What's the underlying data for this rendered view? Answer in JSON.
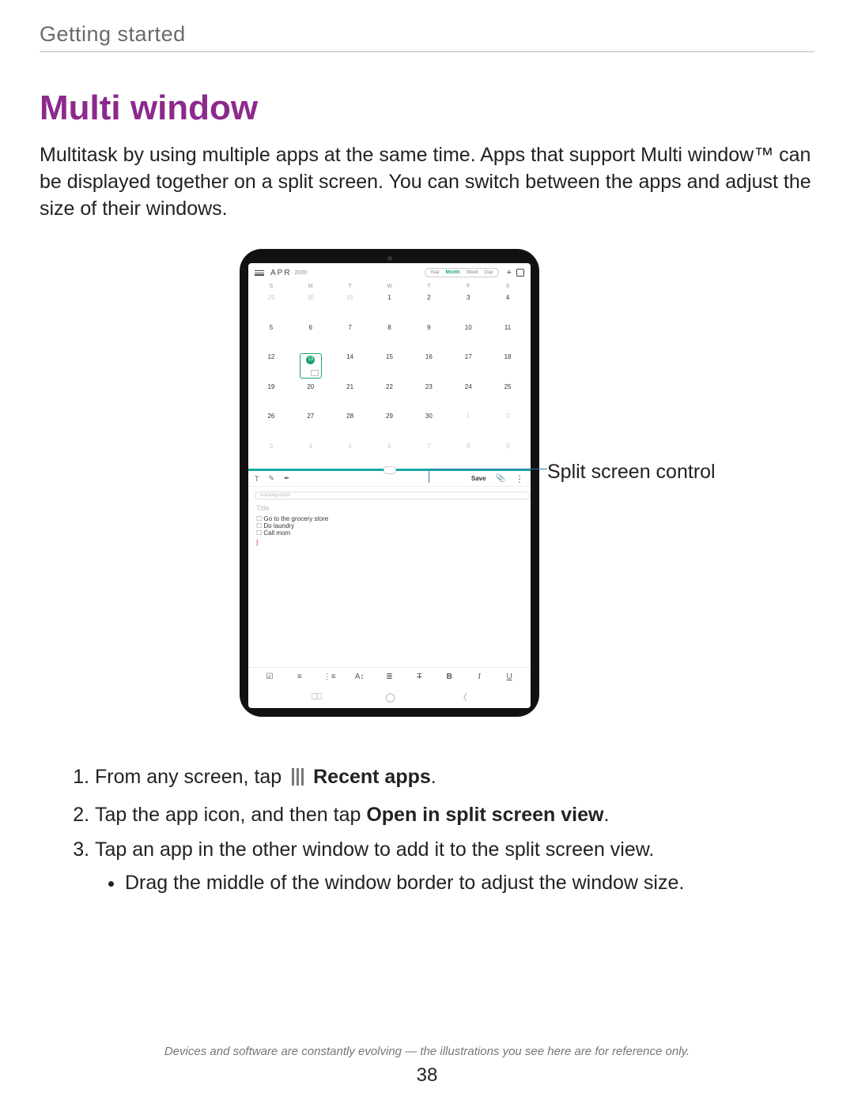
{
  "section_label": "Getting started",
  "heading": "Multi window",
  "intro": "Multitask by using multiple apps at the same time. Apps that support Multi window™ can be displayed together on a split screen. You can switch between the apps and adjust the size of their windows.",
  "callout": "Split screen control",
  "calendar": {
    "month": "APR",
    "year": "2020",
    "views": [
      "Year",
      "Month",
      "Week",
      "Day"
    ],
    "selected_view": "Month",
    "dow": [
      "S",
      "M",
      "T",
      "W",
      "T",
      "F",
      "S"
    ],
    "rows": [
      [
        "29",
        "30",
        "31",
        "1",
        "2",
        "3",
        "4"
      ],
      [
        "5",
        "6",
        "7",
        "8",
        "9",
        "10",
        "11"
      ],
      [
        "12",
        "13",
        "14",
        "15",
        "16",
        "17",
        "18"
      ],
      [
        "19",
        "20",
        "21",
        "22",
        "23",
        "24",
        "25"
      ],
      [
        "26",
        "27",
        "28",
        "29",
        "30",
        "1",
        "2"
      ],
      [
        "3",
        "4",
        "5",
        "6",
        "7",
        "8",
        "9"
      ]
    ],
    "faded_prefix": 3,
    "faded_suffix": 9,
    "today_index": [
      2,
      1
    ]
  },
  "note": {
    "save_label": "Save",
    "tag": "uncategorized",
    "title_placeholder": "Title",
    "items": [
      "Go to the grocery store",
      "Do laundry",
      "Call mom"
    ],
    "format_bar": {
      "bold": "B",
      "italic": "I",
      "underline": "U",
      "strike": "T"
    }
  },
  "steps": {
    "s1a": "From any screen, tap",
    "s1b": "Recent apps",
    "s2a": "Tap the app icon, and then tap ",
    "s2b": "Open in split screen view",
    "s3": "Tap an app in the other window to add it to the split screen view.",
    "s3sub": "Drag the middle of the window border to adjust the window size."
  },
  "footnote": "Devices and software are constantly evolving — the illustrations you see here are for reference only.",
  "page_number": "38"
}
